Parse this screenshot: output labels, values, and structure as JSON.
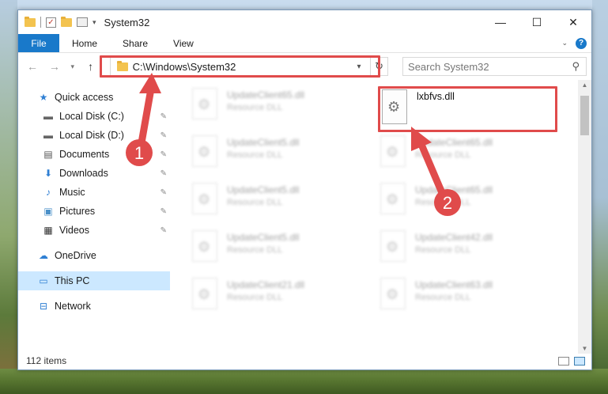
{
  "window": {
    "title": "System32",
    "controls": {
      "minimize": "—",
      "maximize": "☐",
      "close": "✕"
    }
  },
  "ribbon": {
    "file": "File",
    "tabs": [
      "Home",
      "Share",
      "View"
    ],
    "help": "?"
  },
  "navbar": {
    "path": "C:\\Windows\\System32",
    "search_placeholder": "Search System32"
  },
  "sidebar": {
    "items": [
      {
        "label": "Quick access",
        "icon": "star-icon",
        "pinned": false
      },
      {
        "label": "Local Disk (C:)",
        "icon": "drive-icon",
        "pinned": true
      },
      {
        "label": "Local Disk (D:)",
        "icon": "drive-icon",
        "pinned": true
      },
      {
        "label": "Documents",
        "icon": "documents-icon",
        "pinned": true
      },
      {
        "label": "Downloads",
        "icon": "download-icon",
        "pinned": true
      },
      {
        "label": "Music",
        "icon": "music-icon",
        "pinned": true
      },
      {
        "label": "Pictures",
        "icon": "pictures-icon",
        "pinned": true
      },
      {
        "label": "Videos",
        "icon": "video-icon",
        "pinned": true
      },
      {
        "label": "OneDrive",
        "icon": "cloud-icon"
      },
      {
        "label": "This PC",
        "icon": "computer-icon",
        "selected": true
      },
      {
        "label": "Network",
        "icon": "network-icon"
      }
    ]
  },
  "files": {
    "target": {
      "name": "lxbfvs.dll"
    },
    "blurred": [
      {
        "name": "UpdateClient65.dll",
        "type": "Resource DLL"
      },
      {
        "name": "UpdateClient5.dll",
        "type": "Resource DLL"
      },
      {
        "name": "UpdateClient65.dll",
        "type": "Resource DLL"
      },
      {
        "name": "UpdateClient5.dll",
        "type": "Resource DLL"
      },
      {
        "name": "UpdateClient65.dll",
        "type": "Resource DLL"
      },
      {
        "name": "UpdateClient5.dll",
        "type": "Resource DLL"
      },
      {
        "name": "UpdateClient42.dll",
        "type": "Resource DLL"
      },
      {
        "name": "UpdateClient21.dll",
        "type": "Resource DLL"
      },
      {
        "name": "UpdateClient63.dll",
        "type": "Resource DLL"
      }
    ]
  },
  "status": {
    "count": "112 items"
  },
  "callouts": {
    "one": "1",
    "two": "2",
    "color": "#e04b4b"
  }
}
